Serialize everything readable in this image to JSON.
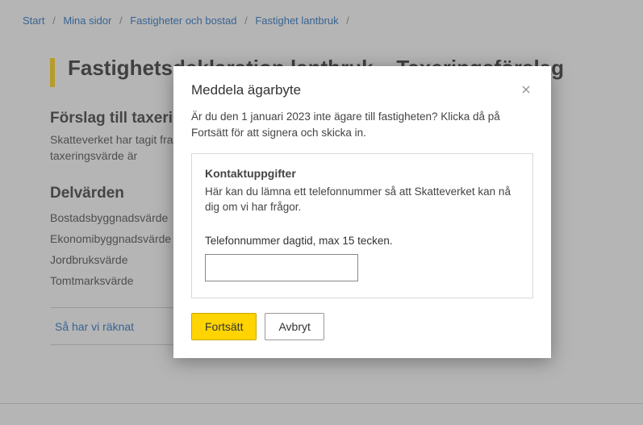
{
  "breadcrumb": {
    "items": [
      {
        "label": "Start"
      },
      {
        "label": "Mina sidor"
      },
      {
        "label": "Fastigheter och bostad"
      },
      {
        "label": "Fastighet lantbruk"
      }
    ]
  },
  "page": {
    "title": "Fastighetsdeklaration lantbruk – Taxeringsförslag"
  },
  "proposal": {
    "heading": "Förslag till taxeringsvärde",
    "lead": "Skatteverket har tagit fram ett förslag till taxeringsvärde för din fastighet. Förslag till taxeringsvärde är"
  },
  "subvalues": {
    "heading": "Delvärden",
    "items": [
      "Bostadsbyggnadsvärde",
      "Ekonomibyggnadsvärde",
      "Jordbruksvärde",
      "Tomtmarksvärde"
    ]
  },
  "accordion": {
    "label": "Så har vi räknat"
  },
  "modal": {
    "title": "Meddela ägarbyte",
    "intro": "Är du den 1 januari 2023 inte ägare till fastigheten? Klicka då på Fortsätt för att signera och skicka in.",
    "contact": {
      "heading": "Kontaktuppgifter",
      "desc": "Här kan du lämna ett telefonnummer så att Skatteverket kan nå dig om vi har frågor.",
      "field_label": "Telefonnummer dagtid, max 15 tecken.",
      "value": ""
    },
    "actions": {
      "continue": "Fortsätt",
      "cancel": "Avbryt"
    }
  }
}
